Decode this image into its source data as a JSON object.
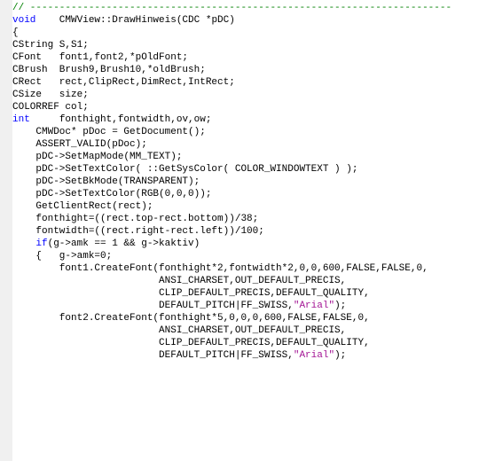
{
  "lines": [
    [
      {
        "c": "cmt",
        "t": "// ------------------------------------------------------------------------"
      }
    ],
    [
      {
        "c": "kw",
        "t": "void"
      },
      {
        "c": "",
        "t": "    CMWView::DrawHinweis(CDC *pDC)"
      }
    ],
    [
      {
        "c": "",
        "t": "{"
      }
    ],
    [
      {
        "c": "",
        "t": "CString S,S1;"
      }
    ],
    [
      {
        "c": "",
        "t": "CFont   font1,font2,*pOldFont;"
      }
    ],
    [
      {
        "c": "",
        "t": "CBrush  Brush9,Brush10,*oldBrush;"
      }
    ],
    [
      {
        "c": "",
        "t": "CRect   rect,ClipRect,DimRect,IntRect;"
      }
    ],
    [
      {
        "c": "",
        "t": "CSize   size;"
      }
    ],
    [
      {
        "c": "",
        "t": "COLORREF col;"
      }
    ],
    [
      {
        "c": "kw",
        "t": "int"
      },
      {
        "c": "",
        "t": "     fonthight,fontwidth,ov,ow;"
      }
    ],
    [
      {
        "c": "",
        "t": ""
      }
    ],
    [
      {
        "c": "",
        "t": "    CMWDoc* pDoc = GetDocument();"
      }
    ],
    [
      {
        "c": "",
        "t": ""
      }
    ],
    [
      {
        "c": "",
        "t": "    ASSERT_VALID(pDoc);"
      }
    ],
    [
      {
        "c": "",
        "t": ""
      }
    ],
    [
      {
        "c": "",
        "t": "    pDC->SetMapMode(MM_TEXT);"
      }
    ],
    [
      {
        "c": "",
        "t": "    pDC->SetTextColor( ::GetSysColor( COLOR_WINDOWTEXT ) );"
      }
    ],
    [
      {
        "c": "",
        "t": "    pDC->SetBkMode(TRANSPARENT);"
      }
    ],
    [
      {
        "c": "",
        "t": "    pDC->SetTextColor(RGB(0,0,0));"
      }
    ],
    [
      {
        "c": "",
        "t": "    GetClientRect(rect);"
      }
    ],
    [
      {
        "c": "",
        "t": ""
      }
    ],
    [
      {
        "c": "",
        "t": "    fonthight=((rect.top-rect.bottom))/38;"
      }
    ],
    [
      {
        "c": "",
        "t": "    fontwidth=((rect.right-rect.left))/100;"
      }
    ],
    [
      {
        "c": "",
        "t": ""
      }
    ],
    [
      {
        "c": "",
        "t": "    "
      },
      {
        "c": "kw",
        "t": "if"
      },
      {
        "c": "",
        "t": "(g->amk == 1 && g->kaktiv)"
      }
    ],
    [
      {
        "c": "",
        "t": "    {   g->amk=0;"
      }
    ],
    [
      {
        "c": "",
        "t": "        font1.CreateFont(fonthight*2,fontwidth*2,0,0,600,FALSE,FALSE,0,"
      }
    ],
    [
      {
        "c": "",
        "t": "                         ANSI_CHARSET,OUT_DEFAULT_PRECIS,"
      }
    ],
    [
      {
        "c": "",
        "t": "                         CLIP_DEFAULT_PRECIS,DEFAULT_QUALITY,"
      }
    ],
    [
      {
        "c": "",
        "t": "                         DEFAULT_PITCH|FF_SWISS,"
      },
      {
        "c": "str",
        "t": "\"Arial\""
      },
      {
        "c": "",
        "t": ");"
      }
    ],
    [
      {
        "c": "",
        "t": ""
      }
    ],
    [
      {
        "c": "",
        "t": "        font2.CreateFont(fonthight*5,0,0,0,600,FALSE,FALSE,0,"
      }
    ],
    [
      {
        "c": "",
        "t": "                         ANSI_CHARSET,OUT_DEFAULT_PRECIS,"
      }
    ],
    [
      {
        "c": "",
        "t": "                         CLIP_DEFAULT_PRECIS,DEFAULT_QUALITY,"
      }
    ],
    [
      {
        "c": "",
        "t": "                         DEFAULT_PITCH|FF_SWISS,"
      },
      {
        "c": "str",
        "t": "\"Arial\""
      },
      {
        "c": "",
        "t": ");"
      }
    ]
  ]
}
